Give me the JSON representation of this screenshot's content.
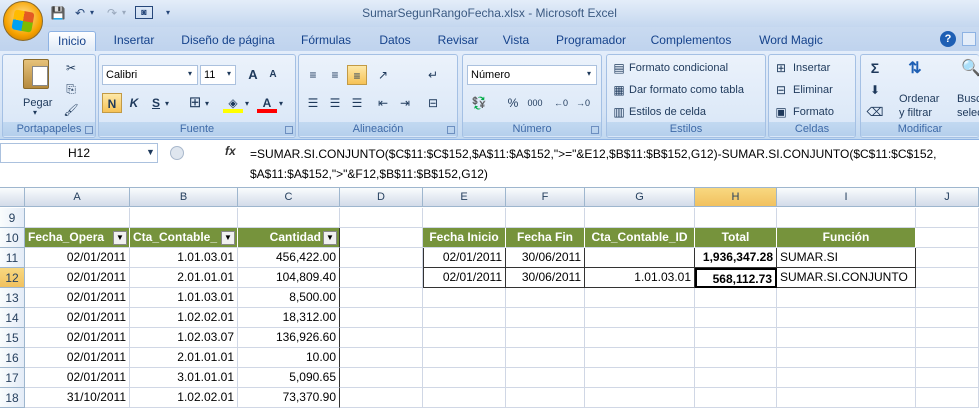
{
  "window": {
    "title": "SumarSegunRangoFecha.xlsx - Microsoft Excel"
  },
  "qat": {
    "save_icon": "save-icon",
    "undo_icon": "undo-icon",
    "redo_icon": "redo-icon",
    "camera_icon": "camera-icon"
  },
  "tabs": [
    "Inicio",
    "Insertar",
    "Diseño de página",
    "Fórmulas",
    "Datos",
    "Revisar",
    "Vista",
    "Programador",
    "Complementos",
    "Word Magic"
  ],
  "active_tab": "Inicio",
  "ribbon": {
    "clipboard": {
      "label": "Portapapeles",
      "paste": "Pegar"
    },
    "font": {
      "label": "Fuente",
      "name": "Calibri",
      "size": "11",
      "bold": "N",
      "italic": "K",
      "underline": "S",
      "grow": "A",
      "shrink": "A",
      "fill_icon": "fill-color-icon",
      "font_color": "A"
    },
    "alignment": {
      "label": "Alineación"
    },
    "number": {
      "label": "Número",
      "format": "Número",
      "percent": "%",
      "thousands": "000"
    },
    "styles": {
      "label": "Estilos",
      "conditional": "Formato condicional",
      "table": "Dar formato como tabla",
      "cell_styles": "Estilos de celda"
    },
    "cells": {
      "label": "Celdas",
      "insert": "Insertar",
      "delete": "Eliminar",
      "format": "Formato"
    },
    "editing": {
      "label": "Modificar",
      "sort": "Ordenar",
      "sort2": "y filtrar",
      "find": "Busc",
      "find2": "selecci"
    }
  },
  "formula_bar": {
    "name_box": "H12",
    "fx": "fx",
    "formula": "=SUMAR.SI.CONJUNTO($C$11:$C$152,$A$11:$A$152,\">=\"&E12,$B$11:$B$152,G12)-SUMAR.SI.CONJUNTO($C$11:$C$152,\n$A$11:$A$152,\">\"&F12,$B$11:$B$152,G12)"
  },
  "columns": [
    "A",
    "B",
    "C",
    "D",
    "E",
    "F",
    "G",
    "H",
    "I",
    "J"
  ],
  "rows": [
    "9",
    "10",
    "11",
    "12",
    "13",
    "14",
    "15",
    "16",
    "17",
    "18"
  ],
  "left_table": {
    "headers": [
      "Fecha_Opera",
      "Cta_Contable_",
      "Cantidad"
    ],
    "rows": [
      [
        "02/01/2011",
        "1.01.03.01",
        "456,422.00"
      ],
      [
        "02/01/2011",
        "2.01.01.01",
        "104,809.40"
      ],
      [
        "02/01/2011",
        "1.01.03.01",
        "8,500.00"
      ],
      [
        "02/01/2011",
        "1.02.02.01",
        "18,312.00"
      ],
      [
        "02/01/2011",
        "1.02.03.07",
        "136,926.60"
      ],
      [
        "02/01/2011",
        "2.01.01.01",
        "10.00"
      ],
      [
        "02/01/2011",
        "3.01.01.01",
        "5,090.65"
      ],
      [
        "31/10/2011",
        "1.02.02.01",
        "73,370.90"
      ]
    ]
  },
  "right_table": {
    "headers": [
      "Fecha Inicio",
      "Fecha Fin",
      "Cta_Contable_ID",
      "Total",
      "Función"
    ],
    "rows": [
      [
        "02/01/2011",
        "30/06/2011",
        "",
        "1,936,347.28",
        "SUMAR.SI"
      ],
      [
        "02/01/2011",
        "30/06/2011",
        "1.01.03.01",
        "568,112.73",
        "SUMAR.SI.CONJUNTO"
      ]
    ]
  },
  "colors": {
    "header_green": "#76933c",
    "selection": "#f1c15f",
    "grid": "#d0d7e5"
  }
}
